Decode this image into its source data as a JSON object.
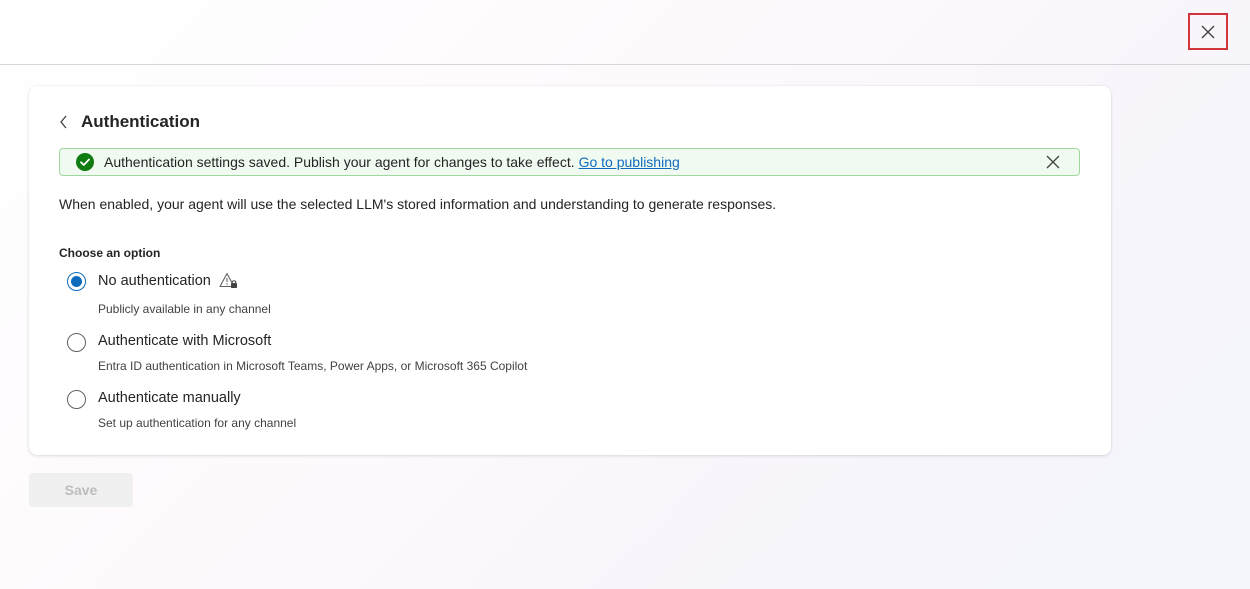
{
  "panel": {
    "close_icon": "close-icon"
  },
  "header": {
    "back_icon": "chevron-left-icon",
    "title": "Authentication"
  },
  "banner": {
    "status_icon": "check-circle-icon",
    "message": "Authentication settings saved. Publish your agent for changes to take effect.",
    "link": "Go to publishing",
    "close_icon": "dismiss-icon",
    "colors": {
      "background": "#f1faf1",
      "border": "#9fd89f",
      "icon": "#107c10",
      "link": "#0f6cbd"
    }
  },
  "description": "When enabled, your agent will use the selected LLM's stored information and understanding to generate responses.",
  "options": {
    "heading": "Choose an option",
    "items": [
      {
        "label": "No authentication",
        "sublabel": "Publicly available in any channel",
        "selected": true,
        "icon": "warning-lock-icon"
      },
      {
        "label": "Authenticate with Microsoft",
        "sublabel": "Entra ID authentication in Microsoft Teams, Power Apps, or Microsoft 365 Copilot",
        "selected": false
      },
      {
        "label": "Authenticate manually",
        "sublabel": "Set up authentication for any channel",
        "selected": false
      }
    ]
  },
  "save": {
    "label": "Save",
    "disabled": true
  },
  "colors": {
    "accent": "#0f6cbd",
    "highlight_border": "#d13438"
  }
}
